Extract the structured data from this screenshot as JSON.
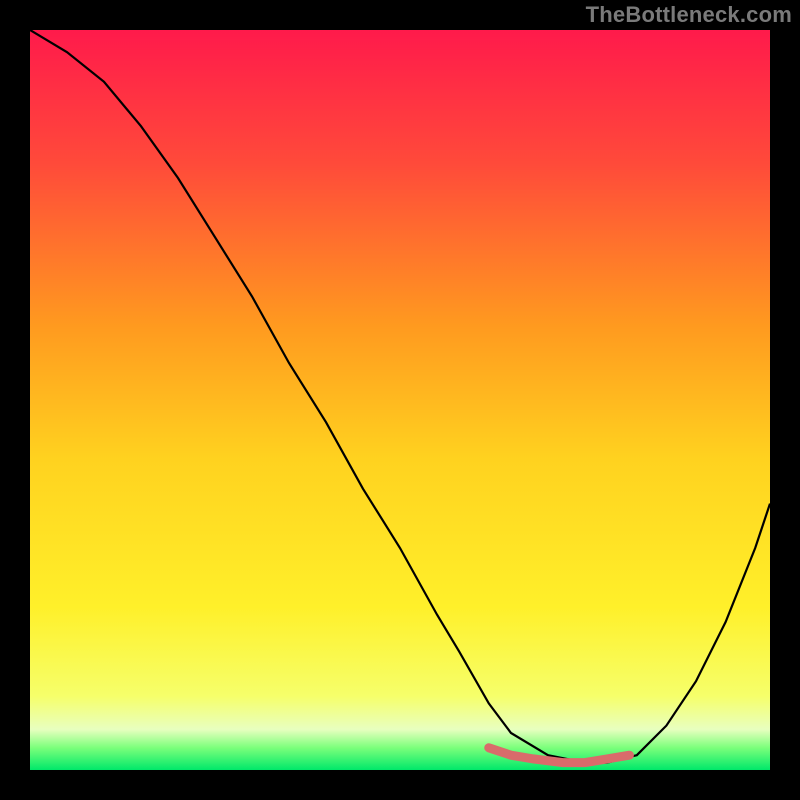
{
  "watermark": "TheBottleneck.com",
  "chart_data": {
    "type": "line",
    "title": "",
    "xlabel": "",
    "ylabel": "",
    "xlim": [
      0,
      100
    ],
    "ylim": [
      0,
      100
    ],
    "grid": false,
    "legend": false,
    "series": [
      {
        "name": "bottleneck-curve",
        "x": [
          0,
          5,
          10,
          15,
          20,
          25,
          30,
          35,
          40,
          45,
          50,
          55,
          58,
          62,
          65,
          70,
          75,
          78,
          82,
          86,
          90,
          94,
          98,
          100
        ],
        "y": [
          100,
          97,
          93,
          87,
          80,
          72,
          64,
          55,
          47,
          38,
          30,
          21,
          16,
          9,
          5,
          2,
          1,
          1,
          2,
          6,
          12,
          20,
          30,
          36
        ]
      },
      {
        "name": "optimal-range-highlight",
        "x": [
          62,
          65,
          68,
          72,
          75,
          78,
          81
        ],
        "y": [
          3,
          2,
          1.5,
          1,
          1,
          1.5,
          2
        ]
      }
    ],
    "gradient_stops": [
      {
        "offset": 0.0,
        "color": "#ff1a4b"
      },
      {
        "offset": 0.18,
        "color": "#ff4a3a"
      },
      {
        "offset": 0.4,
        "color": "#ff9a1f"
      },
      {
        "offset": 0.58,
        "color": "#ffd21f"
      },
      {
        "offset": 0.78,
        "color": "#fff02a"
      },
      {
        "offset": 0.9,
        "color": "#f6ff6a"
      },
      {
        "offset": 0.945,
        "color": "#e8ffbf"
      },
      {
        "offset": 0.97,
        "color": "#7bff7b"
      },
      {
        "offset": 1.0,
        "color": "#00e86a"
      }
    ],
    "curve_color": "#000000",
    "highlight_color": "#d96b6b"
  }
}
